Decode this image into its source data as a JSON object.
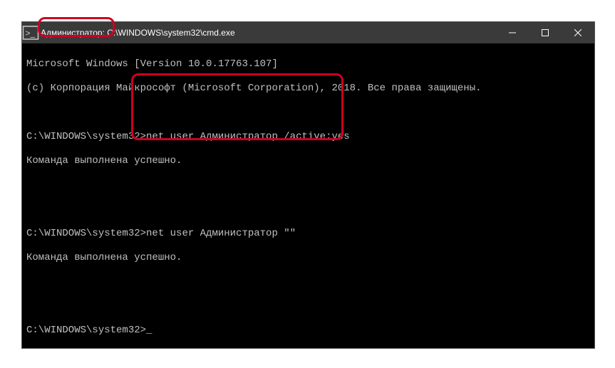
{
  "titlebar": {
    "icon": "cmd-icon",
    "prefix": "Администратор:",
    "path": "C:\\WINDOWS\\system32\\cmd.exe",
    "minimize_label": "Minimize",
    "maximize_label": "Maximize",
    "close_label": "Close"
  },
  "terminal": {
    "line1": "Microsoft Windows [Version 10.0.17763.107]",
    "line2": "(c) Корпорация Майкрософт (Microsoft Corporation), 2018. Все права защищены.",
    "blank1": "",
    "prompt1_path": "C:\\WINDOWS\\system32>",
    "cmd1": "net user Администратор /active:yes",
    "result1": "Команда выполнена успешно.",
    "blank2": "",
    "blank3": "",
    "prompt2_path": "C:\\WINDOWS\\system32>",
    "cmd2": "net user Администратор \"\"",
    "result2": "Команда выполнена успешно.",
    "blank4": "",
    "blank5": "",
    "prompt3_path": "C:\\WINDOWS\\system32>",
    "cursor": "_"
  }
}
